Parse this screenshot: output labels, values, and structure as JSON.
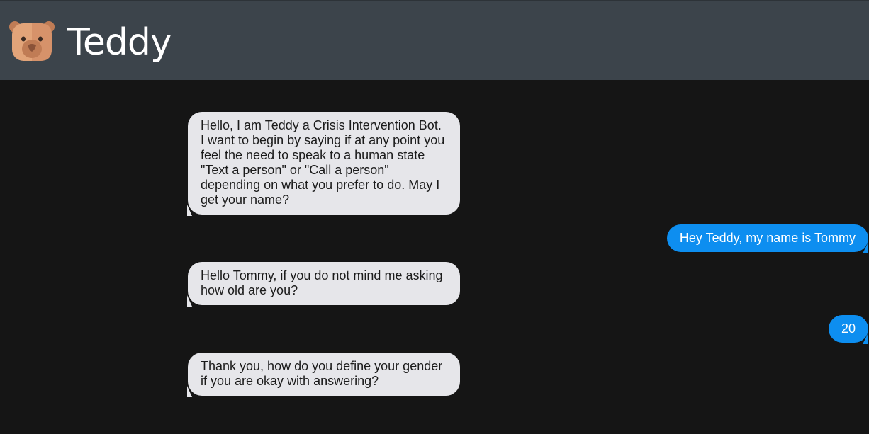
{
  "header": {
    "title": "Teddy",
    "logo_icon": "teddy-bear-icon"
  },
  "messages": [
    {
      "sender": "bot",
      "text": "Hello, I am Teddy a Crisis Intervention Bot. I want to begin by saying if at any point you feel the need to speak to a human state \"Text a person\" or \"Call a person\" depending on what you prefer to do. May I get your name?"
    },
    {
      "sender": "user",
      "text": "Hey Teddy, my name is Tommy"
    },
    {
      "sender": "bot",
      "text": "Hello Tommy, if you do not mind me asking how old are you?"
    },
    {
      "sender": "user",
      "text": "20"
    },
    {
      "sender": "bot",
      "text": "Thank you, how do you define your gender if you are okay with answering?"
    }
  ],
  "colors": {
    "header_bg": "#3c444b",
    "chat_bg": "#151515",
    "bot_bubble": "#e6e6ea",
    "user_bubble": "#0d8ef0"
  }
}
